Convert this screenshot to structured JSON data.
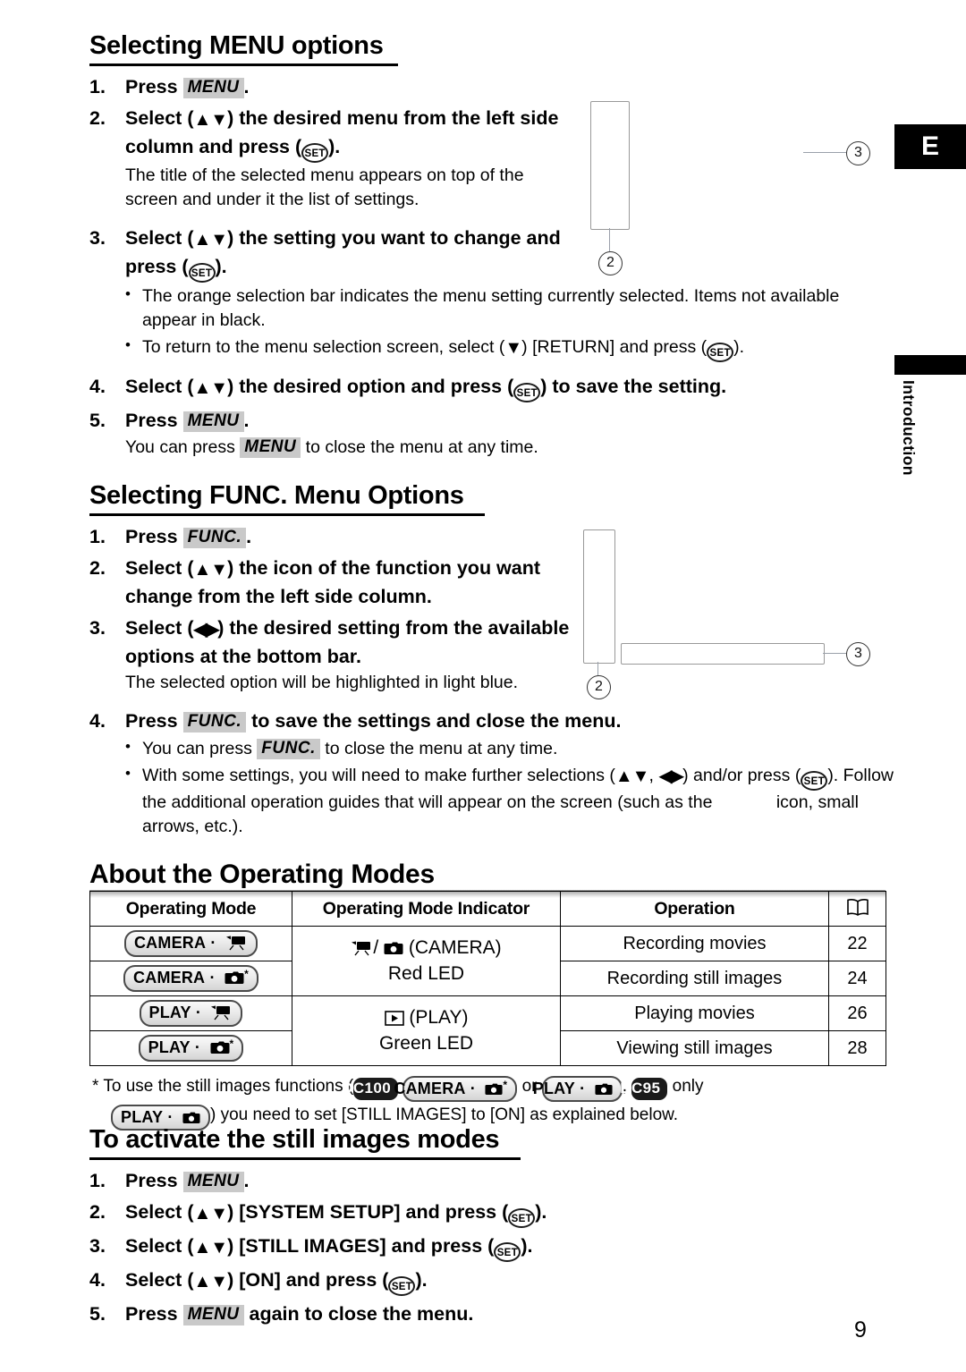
{
  "page": {
    "number": "9",
    "edition_tag": "E",
    "side_tab_label": "Introduction"
  },
  "section1": {
    "title": "Selecting MENU options",
    "steps": [
      {
        "num": "1.",
        "parts": [
          "Press ",
          {
            "kbd": "MENU"
          },
          "."
        ]
      },
      {
        "num": "2.",
        "text_a": "Select (",
        "arrows": "updown",
        "text_b": ") the desired menu from the left side column and press (",
        "set": "SET",
        "text_c": ")."
      },
      {
        "num": "3.",
        "text_a": "Select (",
        "arrows": "updown",
        "text_b": ") the setting you want to change and press (",
        "set": "SET",
        "text_c": ")."
      },
      {
        "num": "4.",
        "text_a": "Select (",
        "arrows": "updown",
        "text_b": ") the desired option and press (",
        "set": "SET",
        "text_c": ") to save the setting."
      },
      {
        "num": "5.",
        "parts": [
          "Press ",
          {
            "kbd": "MENU"
          },
          "."
        ]
      }
    ],
    "note_step2": "The title of the selected menu appears on top of the screen and under it the list of settings.",
    "bullet1": "The orange selection bar indicates the menu setting currently selected. Items not available appear in black.",
    "bullet2_a": "To return to the menu selection screen, select (",
    "bullet2_b": ") [RETURN] and press (",
    "bullet2_c": ").",
    "note_step5_a": "You can press ",
    "note_step5_kbd": "MENU",
    "note_step5_b": " to close the menu at any time.",
    "step1_label": "Press",
    "step1_kbd": "MENU",
    "step1_period": "."
  },
  "section2": {
    "title": "Selecting FUNC. Menu Options",
    "step1_label": "Press",
    "step1_kbd": "FUNC.",
    "step1_period": ".",
    "step2_a": "Select (",
    "step2_b": ") the icon of the function you want change from the left side column.",
    "step3_a": "Select (",
    "step3_b": ") the desired setting from the available options at the bottom bar.",
    "step3_note": "The selected option will be highlighted in light blue.",
    "step4_a": "Press ",
    "step4_kbd": "FUNC.",
    "step4_b": " to save the settings and close the menu.",
    "bullet1_a": "You can press ",
    "bullet1_kbd": "FUNC.",
    "bullet1_b": " to close the menu at any time.",
    "bullet2_a": "With some settings, you will need to make further selections (",
    "bullet2_b": ", ",
    "bullet2_c": ") and/or press (",
    "bullet2_d": "). Follow the additional operation guides that will appear on the screen (such as the",
    "bullet2_e": "icon, small arrows, etc.)."
  },
  "section3": {
    "title": "About the Operating Modes",
    "table": {
      "headers": [
        "Operating Mode",
        "Operating Mode Indicator",
        "Operation",
        "book-icon"
      ],
      "rows": [
        {
          "mode_label": "CAMERA",
          "mode_icon": "camcorder",
          "mode_star": "",
          "operation": "Recording movies",
          "page": "22"
        },
        {
          "mode_label": "CAMERA",
          "mode_icon": "photo",
          "mode_star": "*",
          "operation": "Recording still images",
          "page": "24"
        },
        {
          "mode_label": "PLAY",
          "mode_icon": "camcorder",
          "mode_star": "",
          "operation": "Playing movies",
          "page": "26"
        },
        {
          "mode_label": "PLAY",
          "mode_icon": "photo",
          "mode_star": "*",
          "operation": "Viewing still images",
          "page": "28"
        }
      ],
      "indicators": [
        {
          "name_line": "(CAMERA)",
          "led_line": "Red LED"
        },
        {
          "name_line": "(PLAY)",
          "led_line": "Green LED"
        }
      ]
    },
    "footnote": {
      "lead": "*",
      "part_a": "To use the still images functions (",
      "dc100": "DC100",
      "pill1_label": "CAMERA",
      "pill1_star": "*",
      "or": "or",
      "pill2_label": "PLAY",
      "comma": ",",
      "dc95": "DC95",
      "only": "only",
      "pill3_label": "PLAY",
      "part_b": ") you need to set [STILL IMAGES] to [ON] as explained below."
    }
  },
  "section4": {
    "title": "To activate the still images modes",
    "step1_label": "Press",
    "step1_kbd": "MENU",
    "step1_period": ".",
    "step2_a": "Select (",
    "step2_b": ") [SYSTEM SETUP] and press (",
    "step2_c": ").",
    "step3_a": "Select (",
    "step3_b": ") [STILL IMAGES] and press (",
    "step3_c": ").",
    "step4_a": "Select (",
    "step4_b": ") [ON] and press (",
    "step4_c": ").",
    "step5_a": "Press ",
    "step5_kbd": "MENU",
    "step5_b": " again to close the menu."
  },
  "callouts": {
    "c2": "2",
    "c3": "3",
    "set_label": "SET"
  },
  "numbers": {
    "n1": "1.",
    "n2": "2.",
    "n3": "3.",
    "n4": "4.",
    "n5": "5."
  },
  "colors": {
    "kbd_bg": "#c9c9c9",
    "tag_bg": "#000000",
    "pill_border": "#4a4a4a"
  }
}
